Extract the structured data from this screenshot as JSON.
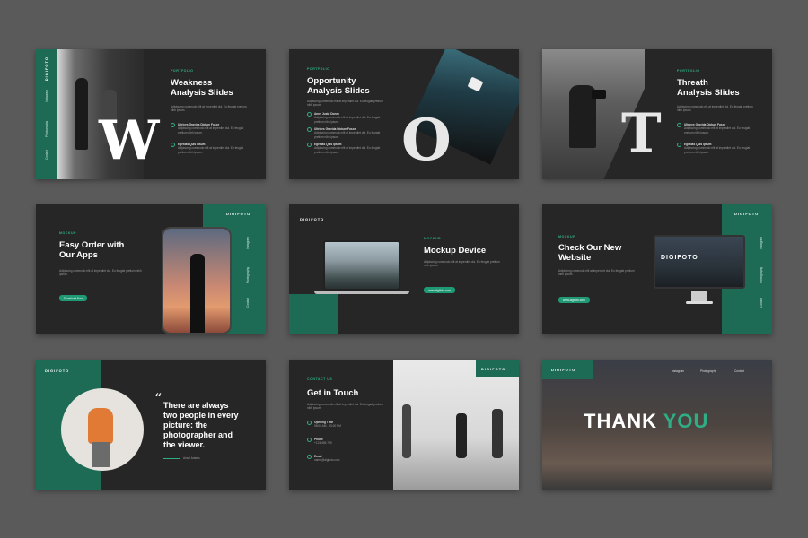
{
  "brand": "DIGIFOTO",
  "lorem": "Adipiscing commodo elit at imperdiet dui. Eu feugiat pretium nibh ipsum.",
  "slides": {
    "weakness": {
      "label": "PORTFOLIO",
      "title_l1": "Weakness",
      "title_l2": "Analysis Slides",
      "letter": "W",
      "b1": "Ultrices Gravida Dictum Fusce",
      "b2": "Egestas Quis Ipsum"
    },
    "opportunity": {
      "label": "PORTFOLIO",
      "title_l1": "Opportunity",
      "title_l2": "Analysis Slides",
      "letter": "O",
      "b1": "Amet Justo Donec",
      "b2": "Ultrices Gravida Dictum Fusce",
      "b3": "Egestas Quis Ipsum"
    },
    "threat": {
      "label": "PORTFOLIO",
      "title_l1": "Threath",
      "title_l2": "Analysis Slides",
      "letter": "T",
      "b1": "Ultrices Gravida Dictum Fusce",
      "b2": "Egestas Quis Ipsum"
    },
    "apps": {
      "label": "MOCKUP",
      "title_l1": "Easy Order with",
      "title_l2": "Our Apps",
      "button": "Download Now"
    },
    "device": {
      "label": "MOCKUP",
      "title": "Mockup Device",
      "button": "www.digifoto.com"
    },
    "website": {
      "label": "MOCKUP",
      "title_l1": "Check Our New",
      "title_l2": "Website",
      "button": "www.digifoto.com",
      "screen_brand": "DIGIFOTO"
    },
    "quote": {
      "mark": "“",
      "text_l1": "There are always",
      "text_l2": "two people in every",
      "text_l3": "picture: the",
      "text_l4": "photographer and",
      "text_l5": "the viewer.",
      "author": "Ansel Adams"
    },
    "contact": {
      "label": "CONTACT US",
      "title": "Get in Touch",
      "opening_label": "Opening Time",
      "opening_value": "08:00 AM - 05:00 PM",
      "phone_label": "Phone",
      "phone_value": "+123 456 789",
      "email_label": "Email",
      "email_value": "name@digifoto.com"
    },
    "thankyou": {
      "word1": "THANK",
      "word2": "YOU",
      "nav1": "Instagram",
      "nav2": "Photography",
      "nav3": "Contact"
    }
  },
  "nav": [
    "Instagram",
    "Photography",
    "Contact"
  ],
  "colors": {
    "bg": "#5a5a5a",
    "slide": "#262626",
    "accent": "#1d6b55",
    "accent_light": "#2fae86"
  }
}
